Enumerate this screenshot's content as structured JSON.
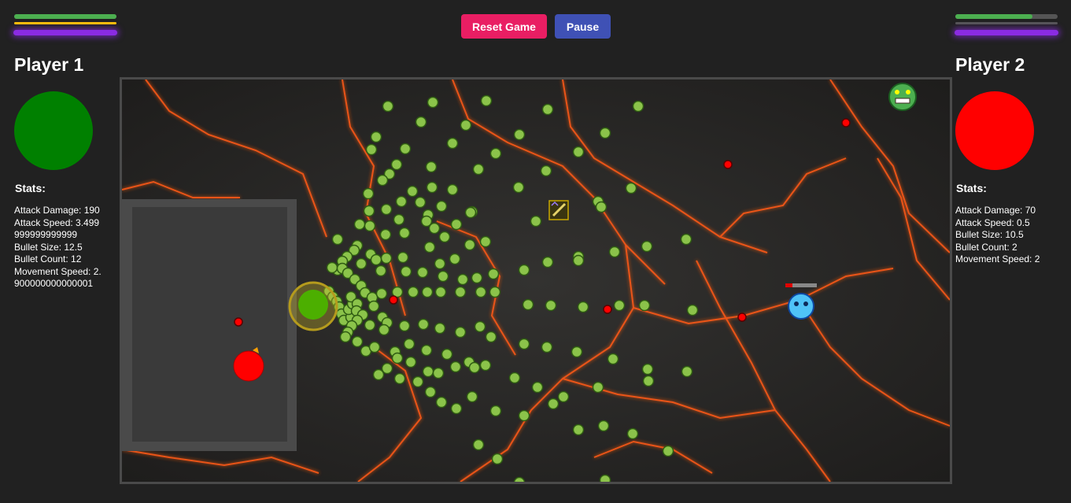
{
  "controls": {
    "reset_label": "Reset Game",
    "pause_label": "Pause"
  },
  "player1": {
    "name": "Player 1",
    "color": "#008000",
    "health_fraction": 1.0,
    "stats_title": "Stats:",
    "stats": [
      "Attack Damage: 190",
      "Attack Speed: 3.499999999999999",
      "Bullet Size: 12.5",
      "Bullet Count: 12",
      "Movement Speed: 2.900000000000001"
    ]
  },
  "player2": {
    "name": "Player 2",
    "color": "#ff0000",
    "health_fraction": 0.75,
    "stats_title": "Stats:",
    "stats": [
      "Attack Damage: 70",
      "Attack Speed: 0.5",
      "Bullet Size: 10.5",
      "Bullet Count: 2",
      "Movement Speed: 2"
    ]
  },
  "arena": {
    "background": "lava-rock-cracks",
    "bullet_color": "#8bc34a",
    "enemy_bullet_color": "#ff0000",
    "icons": [
      "green-monster-icon",
      "blue-ghost-icon",
      "sword-powerup-icon"
    ]
  }
}
